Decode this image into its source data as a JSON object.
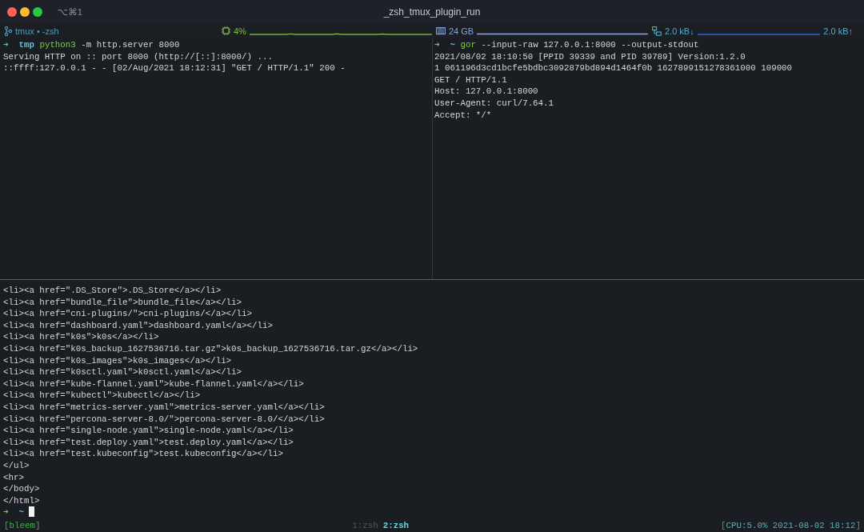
{
  "window": {
    "title": "_zsh_tmux_plugin_run",
    "shortcut": "⌥⌘1"
  },
  "plugin_bar": {
    "session": "tmux • -zsh",
    "cpu": "4%",
    "memory": "24 GB",
    "download": "2.0 kB↓",
    "upload": "2.0 kB↑"
  },
  "top_left_pane": {
    "lines": [
      {
        "kind": "prompt",
        "arrow": "➜",
        "directory": "tmp",
        "command": "python3",
        "arguments": "-m http.server 8000"
      },
      {
        "kind": "output",
        "text": "Serving HTTP on :: port 8000 (http://[::]:8000/) ..."
      },
      {
        "kind": "output",
        "text": "::ffff:127.0.0.1 - - [02/Aug/2021 18:12:31] \"GET / HTTP/1.1\" 200 -"
      }
    ]
  },
  "top_right_pane": {
    "lines": [
      {
        "kind": "prompt",
        "arrow": "➜",
        "directory": "~",
        "command": "gor",
        "arguments": "--input-raw 127.0.0.1:8000 --output-stdout"
      },
      {
        "kind": "output",
        "text": "2021/08/02 18:10:50 [PPID 39339 and PID 39789] Version:1.2.0"
      },
      {
        "kind": "output",
        "text": "1 061196d3cd1bcfe5bdbc3092879bd894d1464f0b 1627899151278361000 109000"
      },
      {
        "kind": "output",
        "text": "GET / HTTP/1.1"
      },
      {
        "kind": "output",
        "text": "Host: 127.0.0.1:8000"
      },
      {
        "kind": "output",
        "text": "User-Agent: curl/7.64.1"
      },
      {
        "kind": "output",
        "text": "Accept: */*"
      }
    ]
  },
  "bottom_pane": {
    "lines": [
      {
        "kind": "output",
        "text": "<li><a href=\".DS_Store\">.DS_Store</a></li>"
      },
      {
        "kind": "output",
        "text": "<li><a href=\"bundle_file\">bundle_file</a></li>"
      },
      {
        "kind": "output",
        "text": "<li><a href=\"cni-plugins/\">cni-plugins/</a></li>"
      },
      {
        "kind": "output",
        "text": "<li><a href=\"dashboard.yaml\">dashboard.yaml</a></li>"
      },
      {
        "kind": "output",
        "text": "<li><a href=\"k0s\">k0s</a></li>"
      },
      {
        "kind": "output",
        "text": "<li><a href=\"k0s_backup_1627536716.tar.gz\">k0s_backup_1627536716.tar.gz</a></li>"
      },
      {
        "kind": "output",
        "text": "<li><a href=\"k0s_images\">k0s_images</a></li>"
      },
      {
        "kind": "output",
        "text": "<li><a href=\"k0sctl.yaml\">k0sctl.yaml</a></li>"
      },
      {
        "kind": "output",
        "text": "<li><a href=\"kube-flannel.yaml\">kube-flannel.yaml</a></li>"
      },
      {
        "kind": "output",
        "text": "<li><a href=\"kubectl\">kubectl</a></li>"
      },
      {
        "kind": "output",
        "text": "<li><a href=\"metrics-server.yaml\">metrics-server.yaml</a></li>"
      },
      {
        "kind": "output",
        "text": "<li><a href=\"percona-server-8.0/\">percona-server-8.0/</a></li>"
      },
      {
        "kind": "output",
        "text": "<li><a href=\"single-node.yaml\">single-node.yaml</a></li>"
      },
      {
        "kind": "output",
        "text": "<li><a href=\"test.deploy.yaml\">test.deploy.yaml</a></li>"
      },
      {
        "kind": "output",
        "text": "<li><a href=\"test.kubeconfig\">test.kubeconfig</a></li>"
      },
      {
        "kind": "output",
        "text": "</ul>"
      },
      {
        "kind": "output",
        "text": "<hr>"
      },
      {
        "kind": "output",
        "text": "</body>"
      },
      {
        "kind": "output",
        "text": "</html>"
      },
      {
        "kind": "prompt",
        "arrow": "➜",
        "directory": "~",
        "cursor": true
      }
    ]
  },
  "tmux_status": {
    "session": "[bleem]",
    "windows": [
      {
        "label": "1:zsh",
        "selected": false
      },
      {
        "label": "2:zsh",
        "selected": true
      }
    ],
    "info": {
      "open": "[",
      "text": "CPU:5.0% 2021-08-02 18:12",
      "close": "]"
    }
  }
}
